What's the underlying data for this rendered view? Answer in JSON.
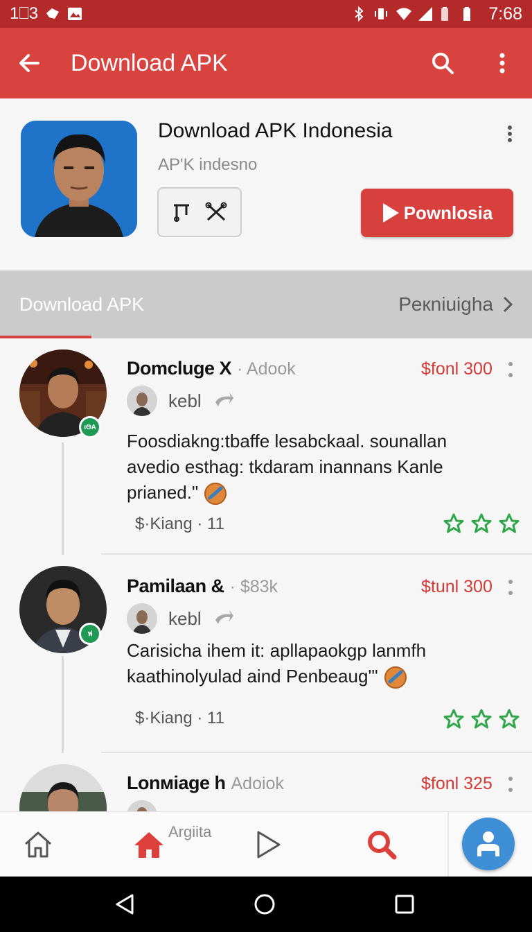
{
  "status_bar": {
    "left_text": "1⎕3",
    "time": "7:68",
    "icons": [
      "notification-icon",
      "gallery-icon",
      "bluetooth-icon",
      "vibrate-icon",
      "wifi-icon",
      "signal-icon",
      "battery-icon",
      "battery-icon"
    ]
  },
  "app_bar": {
    "title": "Download APK",
    "icons": [
      "back-arrow-icon",
      "search-icon",
      "more-vert-icon"
    ]
  },
  "app_header": {
    "name": "Download APK Indonesia",
    "subtitle": "AP'K indesno",
    "download_button": "Pownlosia"
  },
  "section": {
    "title": "Download APK",
    "link": "Peкniuigha"
  },
  "posts": [
    {
      "name": "Domcluge X",
      "handle": "· Adook",
      "price": "$fonl 300",
      "sub_label": "kebl",
      "text": "Foosdiakng:tbaffe lesabckaal. sounallan avedio esthag: tkdaram inannans Kanle prianed.\"",
      "meta": "$·Kiang · 11",
      "stars": 3,
      "badge": "ιΘΑ"
    },
    {
      "name": "Pamilaan &",
      "handle": "· $83k",
      "price": "$tunl 300",
      "sub_label": "kebl",
      "text": "Carisicha ihem it: apllapaokgp lanmfh kaathinolyulad aind Penbeaug'\"",
      "meta": "$·Kiang · 11",
      "stars": 3,
      "badge": "ฟ"
    },
    {
      "name": "Lonмiage h",
      "handle": "Adoiok",
      "price": "$fonl 325",
      "sub_label": "",
      "text": "",
      "meta": "",
      "stars": 0,
      "badge": ""
    }
  ],
  "bottom_nav": {
    "label": "Argiita",
    "icons": [
      "home-outline-icon",
      "home-filled-icon",
      "play-icon",
      "search-icon",
      "profile-icon"
    ]
  },
  "colors": {
    "status_bar": "#b42a2a",
    "app_bar": "#d84340",
    "accent_red": "#d8403d",
    "star_green": "#2fa64a",
    "fab_blue": "#3f8fd6"
  }
}
